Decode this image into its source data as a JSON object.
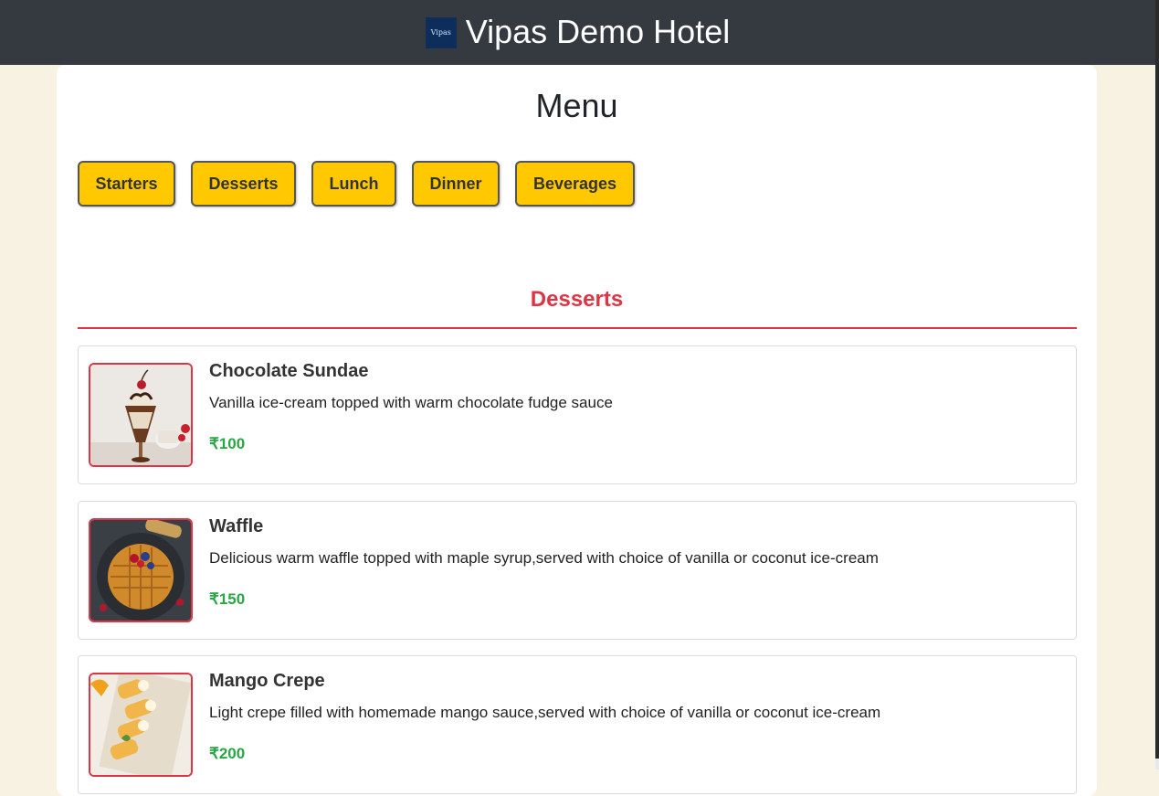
{
  "header": {
    "logo_text": "Vipas",
    "title": "Vipas Demo Hotel"
  },
  "main": {
    "title": "Menu",
    "categories": [
      "Starters",
      "Desserts",
      "Lunch",
      "Dinner",
      "Beverages"
    ],
    "active_section": "Desserts",
    "items": [
      {
        "name": "Chocolate Sundae",
        "description": "Vanilla ice-cream topped with warm chocolate fudge sauce",
        "price": "₹100",
        "image": "chocolate-sundae-image"
      },
      {
        "name": "Waffle",
        "description": "Delicious warm waffle topped with maple syrup,served with choice of vanilla or coconut ice-cream",
        "price": "₹150",
        "image": "waffle-image"
      },
      {
        "name": "Mango Crepe",
        "description": "Light crepe filled with homemade mango sauce,served with choice of vanilla or coconut ice-cream",
        "price": "₹200",
        "image": "mango-crepe-image"
      }
    ]
  },
  "colors": {
    "header_bg": "#343a40",
    "page_bg": "#f8f2e2",
    "category_button": "#ffc800",
    "section_accent": "#dc3545",
    "price": "#28a745"
  }
}
